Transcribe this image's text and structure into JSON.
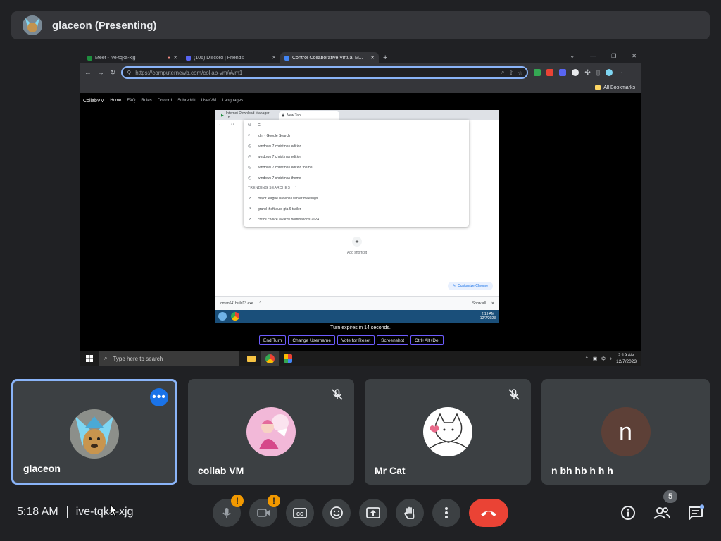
{
  "presenter": {
    "label": "glaceon (Presenting)"
  },
  "browser": {
    "tabs": [
      {
        "label": "Meet - ive-tqka-xjg",
        "favicon": "#1e8e3e"
      },
      {
        "label": "(106) Discord | Friends",
        "favicon": "#5865f2"
      },
      {
        "label": "Control Collaborative Virtual M...",
        "favicon": "#4285f4"
      }
    ],
    "url": "https://computernewb.com/collab-vm/#vm1",
    "bookmarks_label": "All Bookmarks"
  },
  "vmnav": {
    "brand": "CollabVM",
    "items": [
      "Home",
      "FAQ",
      "Rules",
      "Discord",
      "Subreddit",
      "UserVM",
      "Languages"
    ]
  },
  "vm_browser": {
    "tabs": [
      "Internet Download Manager: Th...",
      "New Tab"
    ],
    "typed": "G",
    "suggestions": [
      "ldm - Google Search",
      "windows 7 christmas edition",
      "windows 7 christmas edition",
      "windows 7 christmas edition theme",
      "windows 7 christmas theme"
    ],
    "trending_header": "TRENDING SEARCHES",
    "trending": [
      "major league baseball winter meetings",
      "grand theft auto gta 6 trailer",
      "critics choice awards nominations 2024"
    ],
    "shortcut_label": "Add shortcut",
    "customize_label": "Customize Chrome",
    "download_file": "idman641build13.exe",
    "show_all": "Show all",
    "clock": "2:19 AM",
    "date": "12/7/2023"
  },
  "vm_controls": {
    "turn_text": "Turn expires in 14 seconds.",
    "buttons": [
      "End Turn",
      "Change Username",
      "Vote for Reset",
      "Screenshot",
      "Ctrl+Alt+Del"
    ]
  },
  "taskbar": {
    "search_placeholder": "Type here to search",
    "time": "2:19 AM",
    "date": "12/7/2023"
  },
  "participants": [
    {
      "name": "glaceon"
    },
    {
      "name": "collab VM"
    },
    {
      "name": "Mr Cat"
    },
    {
      "name": "n bh hb h h h",
      "initial": "n"
    }
  ],
  "footer": {
    "time": "5:18 AM",
    "meeting_code": "ive-tqka-xjg",
    "people_count": "5",
    "alert_mark": "!"
  }
}
